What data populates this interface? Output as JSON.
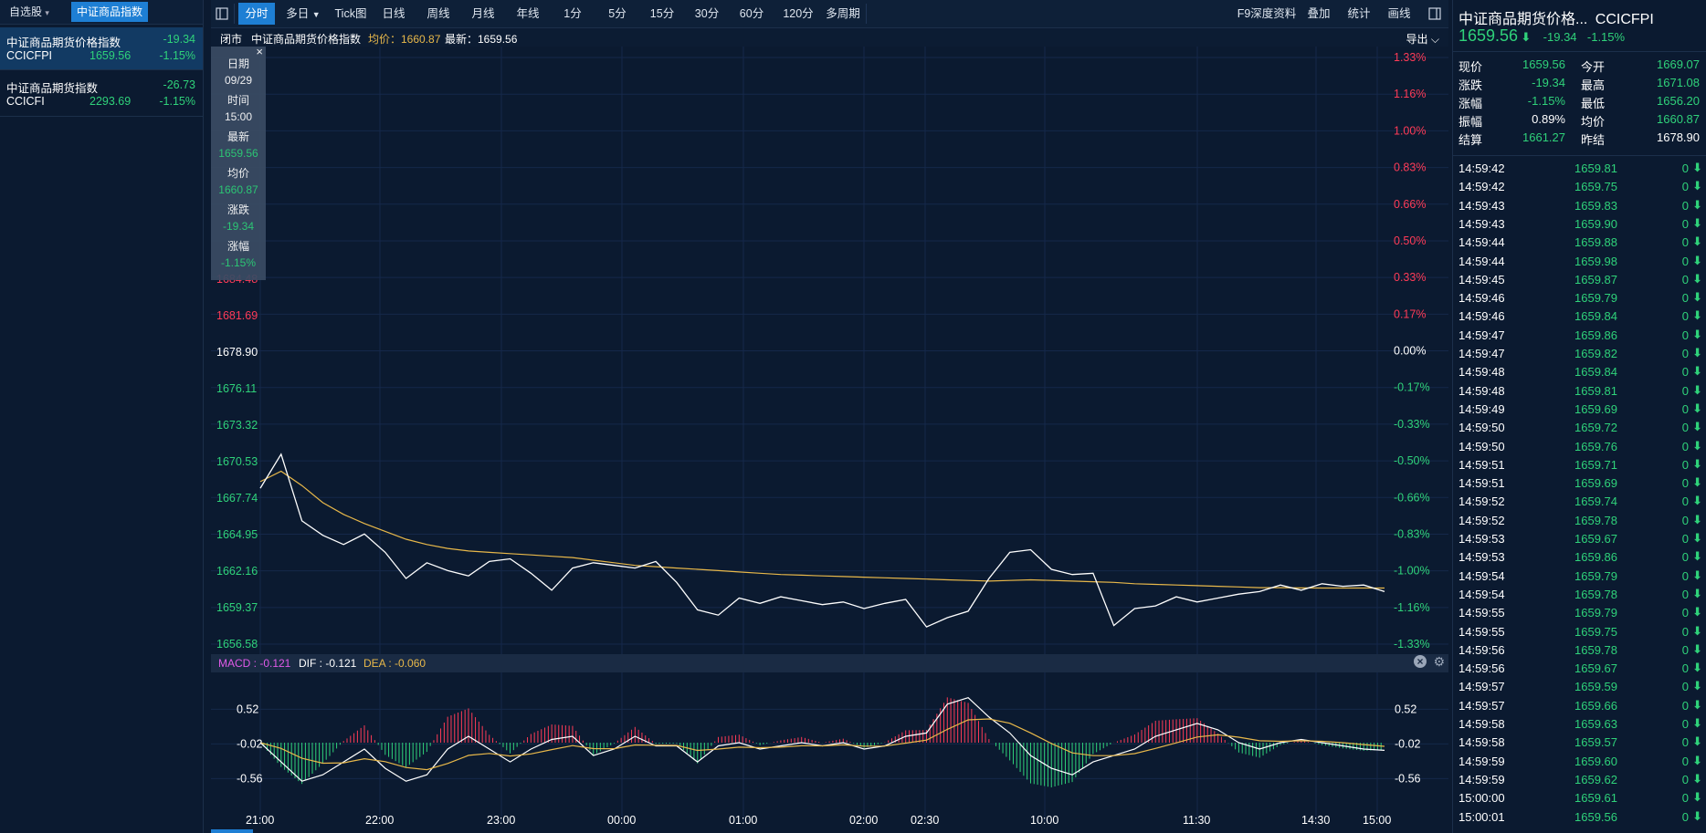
{
  "left": {
    "tabs": [
      "自选股",
      "中证商品指数"
    ],
    "items": [
      {
        "name": "中证商品期货价格指数",
        "code": "CCICFPI",
        "change": "-19.34",
        "price": "1659.56",
        "pct": "-1.15%"
      },
      {
        "name": "中证商品期货指数",
        "code": "CCICFI",
        "change": "-26.73",
        "price": "2293.69",
        "pct": "-1.15%"
      }
    ]
  },
  "toolbar": {
    "tabs": [
      "分时",
      "多日",
      "Tick图",
      "日线",
      "周线",
      "月线",
      "年线",
      "1分",
      "5分",
      "15分",
      "30分",
      "60分",
      "120分",
      "多周期"
    ],
    "right": [
      "F9深度资料",
      "叠加",
      "统计",
      "画线"
    ]
  },
  "info": {
    "status": "闭市",
    "name": "中证商品期货价格指数",
    "avg_label": "均价：1660.87",
    "latest_label": "最新：1659.56",
    "export": "导出"
  },
  "tooltip": {
    "rows": [
      {
        "k": "日期",
        "v": "09/29"
      },
      {
        "k": "时间",
        "v": "15:00"
      },
      {
        "k": "最新",
        "v": "1659.56"
      },
      {
        "k": "均价",
        "v": "1660.87"
      },
      {
        "k": "涨跌",
        "v": "-19.34"
      },
      {
        "k": "涨幅",
        "v": "-1.15%"
      }
    ]
  },
  "price_axis": [
    "1684.48",
    "1681.69",
    "1678.90",
    "1676.11",
    "1673.32",
    "1670.53",
    "1667.74",
    "1664.95",
    "1662.16",
    "1659.37",
    "1656.58"
  ],
  "pct_axis": [
    "1.33%",
    "1.16%",
    "1.00%",
    "0.83%",
    "0.66%",
    "0.50%",
    "0.33%",
    "0.17%",
    "0.00%",
    "-0.17%",
    "-0.33%",
    "-0.50%",
    "-0.66%",
    "-0.83%",
    "-1.00%",
    "-1.16%",
    "-1.33%"
  ],
  "macd": {
    "macd_label": "MACD : -0.121",
    "dif_label": "DIF : -0.121",
    "dea_label": "DEA : -0.060",
    "axis": [
      "0.52",
      "-0.02",
      "-0.56"
    ]
  },
  "time_axis": [
    "21:00",
    "22:00",
    "23:00",
    "00:00",
    "01:00",
    "02:00",
    "02:30",
    "10:00",
    "11:30",
    "14:30",
    "15:00"
  ],
  "chart_data": {
    "type": "line",
    "title": "",
    "prev_close": 1678.9,
    "ylim": [
      1656.58,
      1701.22
    ],
    "series": [
      {
        "values": [
          1668.5,
          1671.1,
          1666.0,
          1664.9,
          1664.2,
          1665.0,
          1663.6,
          1661.6,
          1662.8,
          1662.2,
          1661.8,
          1662.9,
          1663.1,
          1662.0,
          1660.7,
          1662.4,
          1662.8,
          1662.6,
          1662.4,
          1662.9,
          1661.3,
          1659.2,
          1658.8,
          1660.1,
          1659.7,
          1660.2,
          1659.9,
          1659.6,
          1659.8,
          1659.3,
          1659.7,
          1660.0,
          1657.9,
          1658.6,
          1659.1,
          1661.6,
          1663.6,
          1663.8,
          1662.3,
          1661.9,
          1662.0,
          1658.0,
          1659.3,
          1659.5,
          1660.2,
          1659.8,
          1660.1,
          1660.4,
          1660.6,
          1661.1,
          1660.7,
          1661.2,
          1661.0,
          1661.1,
          1660.6
        ]
      },
      {
        "name": "均价",
        "values": [
          1669.0,
          1669.8,
          1668.7,
          1667.4,
          1666.5,
          1665.8,
          1665.2,
          1664.6,
          1664.2,
          1663.9,
          1663.7,
          1663.6,
          1663.5,
          1663.4,
          1663.3,
          1663.2,
          1663.0,
          1662.8,
          1662.6,
          1662.5,
          1662.4,
          1662.3,
          1662.2,
          1662.1,
          1662.0,
          1661.9,
          1661.85,
          1661.8,
          1661.75,
          1661.7,
          1661.65,
          1661.6,
          1661.55,
          1661.5,
          1661.45,
          1661.4,
          1661.45,
          1661.5,
          1661.45,
          1661.4,
          1661.35,
          1661.3,
          1661.2,
          1661.15,
          1661.1,
          1661.05,
          1661.0,
          1660.95,
          1660.9,
          1660.9,
          1660.88,
          1660.87,
          1660.87,
          1660.87,
          1660.87
        ]
      }
    ],
    "macd": {
      "dif": [
        -0.0,
        -0.3,
        -0.6,
        -0.5,
        -0.3,
        -0.1,
        -0.4,
        -0.6,
        -0.5,
        -0.1,
        0.1,
        -0.1,
        -0.3,
        -0.1,
        0.05,
        0.1,
        -0.2,
        -0.1,
        0.1,
        -0.05,
        -0.05,
        -0.3,
        -0.05,
        0.0,
        -0.1,
        -0.05,
        0.0,
        -0.05,
        0.0,
        -0.1,
        -0.05,
        0.1,
        0.15,
        0.6,
        0.7,
        0.4,
        0.15,
        -0.2,
        -0.4,
        -0.5,
        -0.3,
        -0.2,
        -0.1,
        0.1,
        0.2,
        0.3,
        0.2,
        0.0,
        -0.1,
        0.0,
        0.05,
        0.0,
        -0.05,
        -0.1,
        -0.12
      ]
    }
  },
  "right": {
    "title": "中证商品期货价格...",
    "code": "CCICFPI",
    "price": "1659.56",
    "arrow": "⬇",
    "change": "-19.34",
    "pct": "-1.15%",
    "quote": [
      [
        "现价",
        "1659.56",
        "今开",
        "1669.07"
      ],
      [
        "涨跌",
        "-19.34",
        "最高",
        "1671.08"
      ],
      [
        "涨幅",
        "-1.15%",
        "最低",
        "1656.20"
      ],
      [
        "振幅",
        "0.89%",
        "均价",
        "1660.87"
      ],
      [
        "结算",
        "1661.27",
        "昨结",
        "1678.90"
      ]
    ],
    "ticks": [
      [
        "14:59:42",
        "1659.81",
        "0"
      ],
      [
        "14:59:42",
        "1659.75",
        "0"
      ],
      [
        "14:59:43",
        "1659.83",
        "0"
      ],
      [
        "14:59:43",
        "1659.90",
        "0"
      ],
      [
        "14:59:44",
        "1659.88",
        "0"
      ],
      [
        "14:59:44",
        "1659.98",
        "0"
      ],
      [
        "14:59:45",
        "1659.87",
        "0"
      ],
      [
        "14:59:46",
        "1659.79",
        "0"
      ],
      [
        "14:59:46",
        "1659.84",
        "0"
      ],
      [
        "14:59:47",
        "1659.86",
        "0"
      ],
      [
        "14:59:47",
        "1659.82",
        "0"
      ],
      [
        "14:59:48",
        "1659.84",
        "0"
      ],
      [
        "14:59:48",
        "1659.81",
        "0"
      ],
      [
        "14:59:49",
        "1659.69",
        "0"
      ],
      [
        "14:59:50",
        "1659.72",
        "0"
      ],
      [
        "14:59:50",
        "1659.76",
        "0"
      ],
      [
        "14:59:51",
        "1659.71",
        "0"
      ],
      [
        "14:59:51",
        "1659.69",
        "0"
      ],
      [
        "14:59:52",
        "1659.74",
        "0"
      ],
      [
        "14:59:52",
        "1659.78",
        "0"
      ],
      [
        "14:59:53",
        "1659.67",
        "0"
      ],
      [
        "14:59:53",
        "1659.86",
        "0"
      ],
      [
        "14:59:54",
        "1659.79",
        "0"
      ],
      [
        "14:59:54",
        "1659.78",
        "0"
      ],
      [
        "14:59:55",
        "1659.79",
        "0"
      ],
      [
        "14:59:55",
        "1659.75",
        "0"
      ],
      [
        "14:59:56",
        "1659.78",
        "0"
      ],
      [
        "14:59:56",
        "1659.67",
        "0"
      ],
      [
        "14:59:57",
        "1659.59",
        "0"
      ],
      [
        "14:59:57",
        "1659.66",
        "0"
      ],
      [
        "14:59:58",
        "1659.63",
        "0"
      ],
      [
        "14:59:58",
        "1659.57",
        "0"
      ],
      [
        "14:59:59",
        "1659.60",
        "0"
      ],
      [
        "14:59:59",
        "1659.62",
        "0"
      ],
      [
        "15:00:00",
        "1659.61",
        "0"
      ],
      [
        "15:00:01",
        "1659.56",
        "0"
      ]
    ],
    "tick_arrow": "⬇"
  },
  "colors": {
    "up": "#ff3b57",
    "down": "#2fd27a",
    "accent": "#1e7fd4",
    "avg": "#e8b84a"
  }
}
